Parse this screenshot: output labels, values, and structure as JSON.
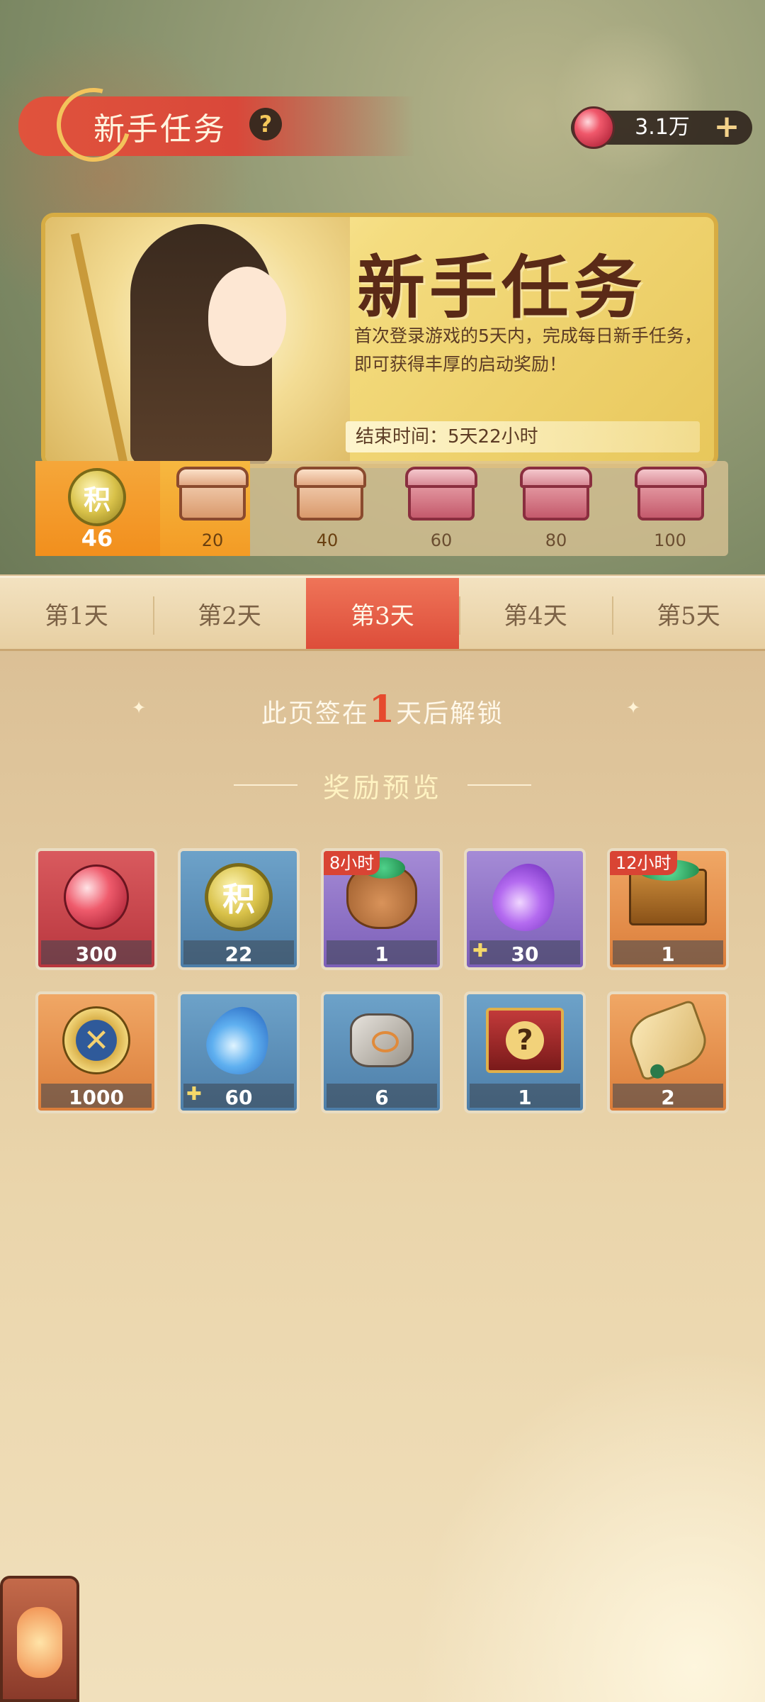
{
  "header": {
    "title": "新手任务",
    "help_icon": "?",
    "currency": {
      "icon": "red-orb-icon",
      "value": "3.1万",
      "add_label": "+"
    }
  },
  "event_card": {
    "title": "新手任务",
    "description": "首次登录游戏的5天内，完成每日新手任务，即可获得丰厚的启动奖励！",
    "end_time": "结束时间：5天22小时"
  },
  "progress": {
    "points_icon_label": "积",
    "current_points": "46",
    "fill_fraction": 0.31,
    "milestones": [
      {
        "label": "20",
        "chest": "gold-chest-icon",
        "reached": true
      },
      {
        "label": "40",
        "chest": "gold-chest-icon",
        "reached": true
      },
      {
        "label": "60",
        "chest": "pink-chest-icon",
        "reached": false
      },
      {
        "label": "80",
        "chest": "pink-chest-icon",
        "reached": false
      },
      {
        "label": "100",
        "chest": "pink-chest-icon",
        "reached": false
      }
    ]
  },
  "tabs": [
    {
      "label": "第1天",
      "active": false
    },
    {
      "label": "第2天",
      "active": false
    },
    {
      "label": "第3天",
      "active": true
    },
    {
      "label": "第4天",
      "active": false
    },
    {
      "label": "第5天",
      "active": false
    }
  ],
  "unlock": {
    "prefix": "此页签在",
    "days": "1",
    "suffix": "天后解锁"
  },
  "rewards_title": "奖励预览",
  "rewards": [
    {
      "icon": "red-orb-icon",
      "count": "300",
      "timer": ""
    },
    {
      "icon": "points-coin-icon",
      "count": "22",
      "timer": "",
      "glyph": "积"
    },
    {
      "icon": "jade-bag-icon",
      "count": "1",
      "timer": "8小时"
    },
    {
      "icon": "purple-flame-icon",
      "count": "30",
      "timer": ""
    },
    {
      "icon": "jade-treasure-chest-icon",
      "count": "1",
      "timer": "12小时"
    },
    {
      "icon": "gold-medal-icon",
      "count": "1000",
      "timer": ""
    },
    {
      "icon": "blue-flame-icon",
      "count": "60",
      "timer": ""
    },
    {
      "icon": "enhancement-stone-icon",
      "count": "6",
      "timer": ""
    },
    {
      "icon": "mystery-box-icon",
      "count": "1",
      "timer": "",
      "glyph": "?"
    },
    {
      "icon": "scroll-icon",
      "count": "2",
      "timer": ""
    }
  ],
  "colors": {
    "active_tab": "#dd4d3a",
    "title_banner": "#d9483a",
    "progress_fill": "#f39b25"
  }
}
